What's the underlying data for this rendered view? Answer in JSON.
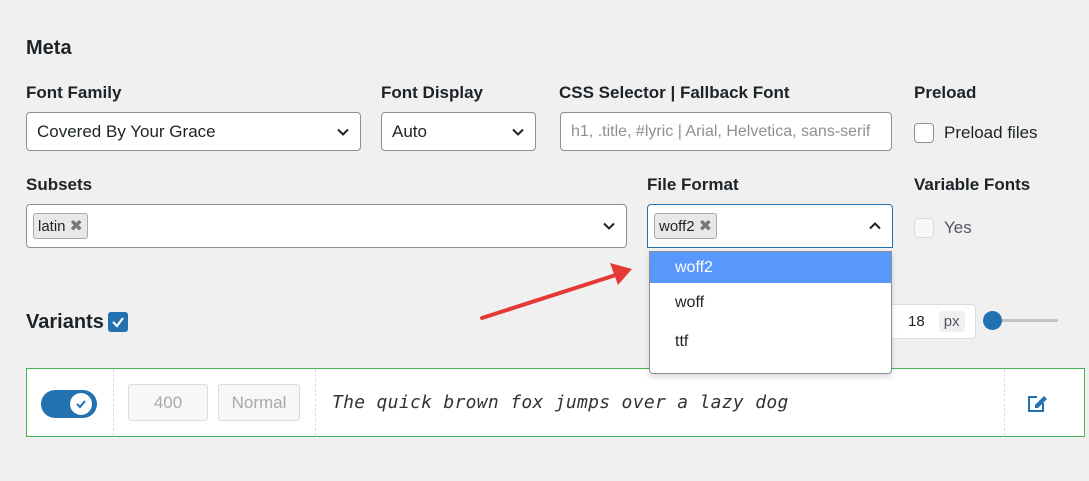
{
  "meta": {
    "heading": "Meta",
    "font_family": {
      "label": "Font Family",
      "value": "Covered By Your Grace"
    },
    "font_display": {
      "label": "Font Display",
      "value": "Auto"
    },
    "css_selector": {
      "label": "CSS Selector | Fallback Font",
      "placeholder": "h1, .title, #lyric | Arial, Helvetica, sans-serif"
    },
    "preload": {
      "label": "Preload",
      "checkbox_label": "Preload files"
    },
    "subsets": {
      "label": "Subsets",
      "selected_tag": "latin"
    },
    "file_format": {
      "label": "File Format",
      "selected_tag": "woff2",
      "options": [
        "woff2",
        "woff",
        "ttf"
      ],
      "highlighted": "woff2"
    },
    "variable_fonts": {
      "label": "Variable Fonts",
      "checkbox_label": "Yes"
    }
  },
  "variants": {
    "heading": "Variants",
    "size_value": "18",
    "size_unit": "px",
    "row": {
      "weight": "400",
      "style": "Normal",
      "preview": "The quick brown fox jumps over a lazy dog"
    }
  },
  "colors": {
    "accent": "#2271b1",
    "dropdown_highlight": "#5897fb",
    "row_border": "#46b450",
    "arrow": "#e53935"
  }
}
